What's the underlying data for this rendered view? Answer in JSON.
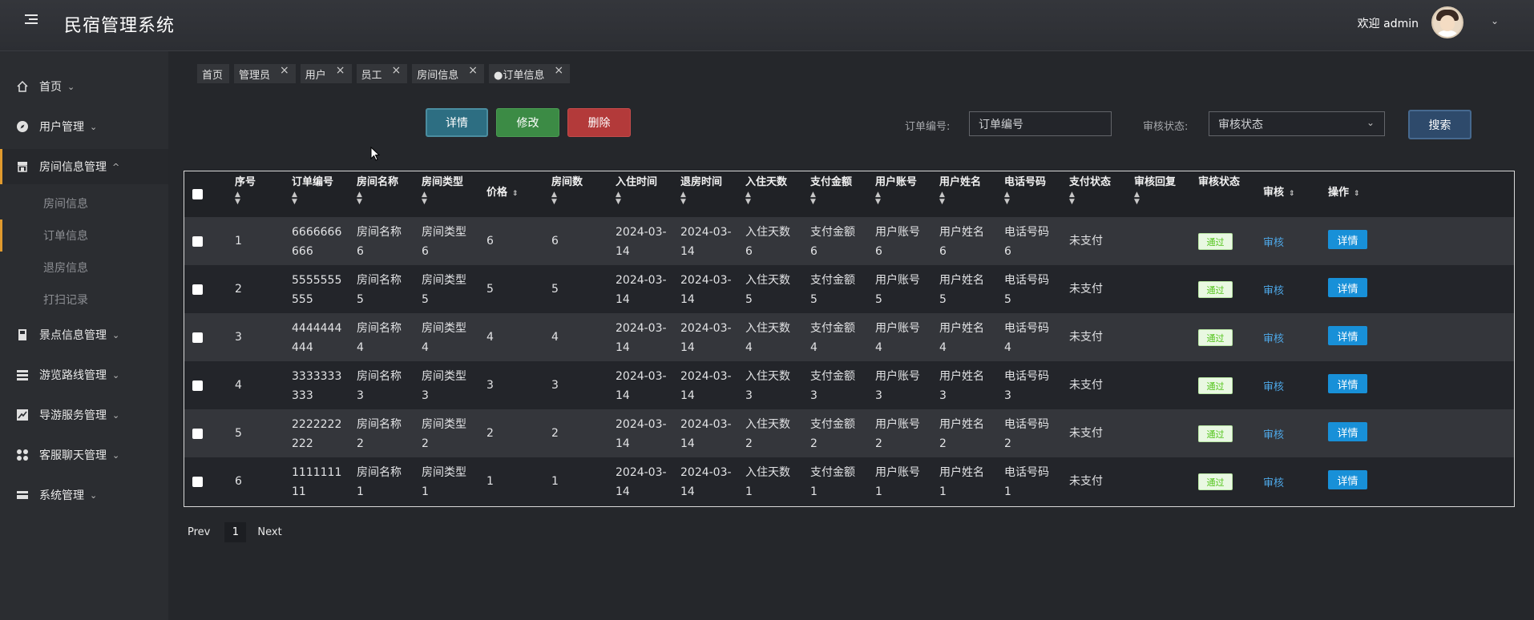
{
  "header": {
    "title": "民宿管理系统",
    "welcome": "欢迎 admin"
  },
  "sidebar": {
    "items": [
      {
        "label": "首页",
        "icon": "home-icon"
      },
      {
        "label": "用户管理",
        "icon": "compass-icon"
      },
      {
        "label": "房间信息管理",
        "icon": "store-icon",
        "expanded": true,
        "children": [
          "房间信息",
          "订单信息",
          "退房信息",
          "打扫记录"
        ]
      },
      {
        "label": "景点信息管理",
        "icon": "book-icon"
      },
      {
        "label": "游览路线管理",
        "icon": "list-icon"
      },
      {
        "label": "导游服务管理",
        "icon": "chart-icon"
      },
      {
        "label": "客服聊天管理",
        "icon": "grid-icon"
      },
      {
        "label": "系统管理",
        "icon": "card-icon"
      }
    ]
  },
  "tabs": [
    "首页",
    "管理员",
    "用户",
    "员工",
    "房间信息",
    "●订单信息"
  ],
  "toolbar": {
    "detail": "详情",
    "edit": "修改",
    "delete": "删除",
    "search": "搜索"
  },
  "filters": {
    "order_label": "订单编号:",
    "order_placeholder": "订单编号",
    "status_label": "审核状态:",
    "status_value": "审核状态"
  },
  "table": {
    "headers": [
      "序号",
      "订单编号",
      "房间名称",
      "房间类型",
      "价格",
      "房间数",
      "入住时间",
      "退房时间",
      "入住天数",
      "支付金额",
      "用户账号",
      "用户姓名",
      "电话号码",
      "支付状态",
      "审核回复",
      "审核状态",
      "审核",
      "操作"
    ],
    "rows": [
      {
        "idx": "1",
        "order1": "6666666",
        "order2": "666",
        "name1": "房间名称",
        "name2": "6",
        "type1": "房间类型",
        "type2": "6",
        "price": "6",
        "count": "6",
        "in1": "2024-03-",
        "in2": "14",
        "out1": "2024-03-",
        "out2": "14",
        "days1": "入住天数",
        "days2": "6",
        "amt1": "支付金额",
        "amt2": "6",
        "acct1": "用户账号",
        "acct2": "6",
        "uname1": "用户姓名",
        "uname2": "6",
        "phone1": "电话号码",
        "phone2": "6",
        "pay": "未支付",
        "status": "通过",
        "audit": "审核",
        "op": "详情"
      },
      {
        "idx": "2",
        "order1": "5555555",
        "order2": "555",
        "name1": "房间名称",
        "name2": "5",
        "type1": "房间类型",
        "type2": "5",
        "price": "5",
        "count": "5",
        "in1": "2024-03-",
        "in2": "14",
        "out1": "2024-03-",
        "out2": "14",
        "days1": "入住天数",
        "days2": "5",
        "amt1": "支付金额",
        "amt2": "5",
        "acct1": "用户账号",
        "acct2": "5",
        "uname1": "用户姓名",
        "uname2": "5",
        "phone1": "电话号码",
        "phone2": "5",
        "pay": "未支付",
        "status": "通过",
        "audit": "审核",
        "op": "详情"
      },
      {
        "idx": "3",
        "order1": "4444444",
        "order2": "444",
        "name1": "房间名称",
        "name2": "4",
        "type1": "房间类型",
        "type2": "4",
        "price": "4",
        "count": "4",
        "in1": "2024-03-",
        "in2": "14",
        "out1": "2024-03-",
        "out2": "14",
        "days1": "入住天数",
        "days2": "4",
        "amt1": "支付金额",
        "amt2": "4",
        "acct1": "用户账号",
        "acct2": "4",
        "uname1": "用户姓名",
        "uname2": "4",
        "phone1": "电话号码",
        "phone2": "4",
        "pay": "未支付",
        "status": "通过",
        "audit": "审核",
        "op": "详情"
      },
      {
        "idx": "4",
        "order1": "3333333",
        "order2": "333",
        "name1": "房间名称",
        "name2": "3",
        "type1": "房间类型",
        "type2": "3",
        "price": "3",
        "count": "3",
        "in1": "2024-03-",
        "in2": "14",
        "out1": "2024-03-",
        "out2": "14",
        "days1": "入住天数",
        "days2": "3",
        "amt1": "支付金额",
        "amt2": "3",
        "acct1": "用户账号",
        "acct2": "3",
        "uname1": "用户姓名",
        "uname2": "3",
        "phone1": "电话号码",
        "phone2": "3",
        "pay": "未支付",
        "status": "通过",
        "audit": "审核",
        "op": "详情"
      },
      {
        "idx": "5",
        "order1": "2222222",
        "order2": "222",
        "name1": "房间名称",
        "name2": "2",
        "type1": "房间类型",
        "type2": "2",
        "price": "2",
        "count": "2",
        "in1": "2024-03-",
        "in2": "14",
        "out1": "2024-03-",
        "out2": "14",
        "days1": "入住天数",
        "days2": "2",
        "amt1": "支付金额",
        "amt2": "2",
        "acct1": "用户账号",
        "acct2": "2",
        "uname1": "用户姓名",
        "uname2": "2",
        "phone1": "电话号码",
        "phone2": "2",
        "pay": "未支付",
        "status": "通过",
        "audit": "审核",
        "op": "详情"
      },
      {
        "idx": "6",
        "order1": "1111111",
        "order2": "11",
        "name1": "房间名称",
        "name2": "1",
        "type1": "房间类型",
        "type2": "1",
        "price": "1",
        "count": "1",
        "in1": "2024-03-",
        "in2": "14",
        "out1": "2024-03-",
        "out2": "14",
        "days1": "入住天数",
        "days2": "1",
        "amt1": "支付金额",
        "amt2": "1",
        "acct1": "用户账号",
        "acct2": "1",
        "uname1": "用户姓名",
        "uname2": "1",
        "phone1": "电话号码",
        "phone2": "1",
        "pay": "未支付",
        "status": "通过",
        "audit": "审核",
        "op": "详情"
      }
    ]
  },
  "pagination": {
    "prev": "Prev",
    "page": "1",
    "next": "Next"
  },
  "colors": {
    "accent": "#e09a2e",
    "link": "#4ea8e8",
    "primary_btn": "#1890d8",
    "success": "#52c41a"
  }
}
